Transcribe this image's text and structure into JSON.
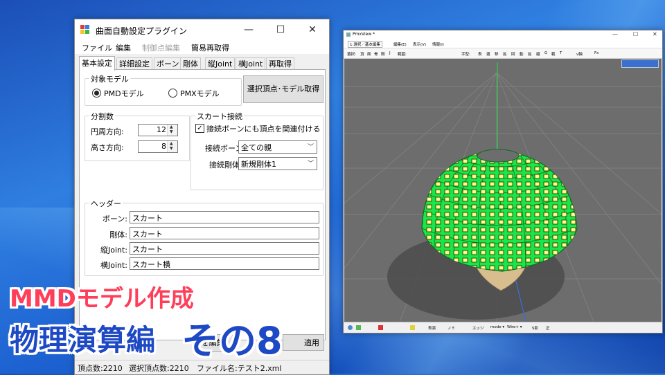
{
  "plugin_window": {
    "title": "曲面自動設定プラグイン",
    "controls": {
      "minimize": "—",
      "maximize": "☐",
      "close": "✕"
    },
    "menu": [
      {
        "label": "ファイル",
        "enabled": true
      },
      {
        "label": "編集",
        "enabled": true
      },
      {
        "label": "制御点編集",
        "enabled": false
      },
      {
        "label": "簡易再取得",
        "enabled": true
      }
    ],
    "tabs": [
      "基本設定",
      "詳細設定",
      "ボーン",
      "剛体",
      "縦Joint",
      "横Joint",
      "再取得"
    ],
    "active_tab": "基本設定",
    "target_model": {
      "title": "対象モデル",
      "options": [
        "PMDモデル",
        "PMXモデル"
      ],
      "selected": "PMDモデル"
    },
    "fetch_button": "選択頂点･モデル取得",
    "division": {
      "title": "分割数",
      "circumference_label": "円周方向:",
      "circumference_value": "12",
      "height_label": "高さ方向:",
      "height_value": "8"
    },
    "skirt": {
      "title": "スカート接続",
      "checkbox_label": "接続ボーンにも頂点を関連付ける",
      "checked": true,
      "bone_label": "接続ボーン:",
      "bone_value": "全ての親",
      "body_label": "接続剛体:",
      "body_value": "新規剛体1"
    },
    "header": {
      "title": "ヘッダー",
      "rows": [
        {
          "label": "ボーン:",
          "value": "スカート"
        },
        {
          "label": "剛体:",
          "value": "スカート"
        },
        {
          "label": "縦Joint:",
          "value": "スカート"
        },
        {
          "label": "横Joint:",
          "value": "スカート横"
        }
      ]
    },
    "bottom_buttons": [
      "を編集",
      "適用"
    ],
    "status": {
      "vertex_count": "頂点数:2210",
      "selected_count": "選択頂点数:2210",
      "file_name": "ファイル名:テスト2.xml"
    }
  },
  "viewer_window": {
    "title": "PmxView *",
    "menu": [
      "1:選択／基本編集",
      "編集(E)",
      "表示(V)",
      "情報(I)"
    ],
    "toolbar": [
      "選択:",
      "頂",
      "面",
      "骨",
      "剛",
      "J",
      "範囲:",
      "字型:",
      "表",
      "選",
      "移",
      "拡",
      "回",
      "動",
      "拡",
      "縮",
      "G",
      "範",
      "T",
      "v軸",
      "Fx"
    ],
    "bottom": [
      "表演",
      "ノミ",
      "エッジ",
      "mode ▾",
      "Wire+ ▾",
      "S影",
      "正"
    ],
    "colors": {
      "viewport_bg": "#6d6d6d",
      "mesh_green": "#19e64b",
      "bone_yellow": "#f2f060",
      "base_tan": "#d8bd8e"
    }
  },
  "overlay": {
    "line1": "MMDモデル作成",
    "line2": "物理演算編",
    "line3": "その8"
  }
}
